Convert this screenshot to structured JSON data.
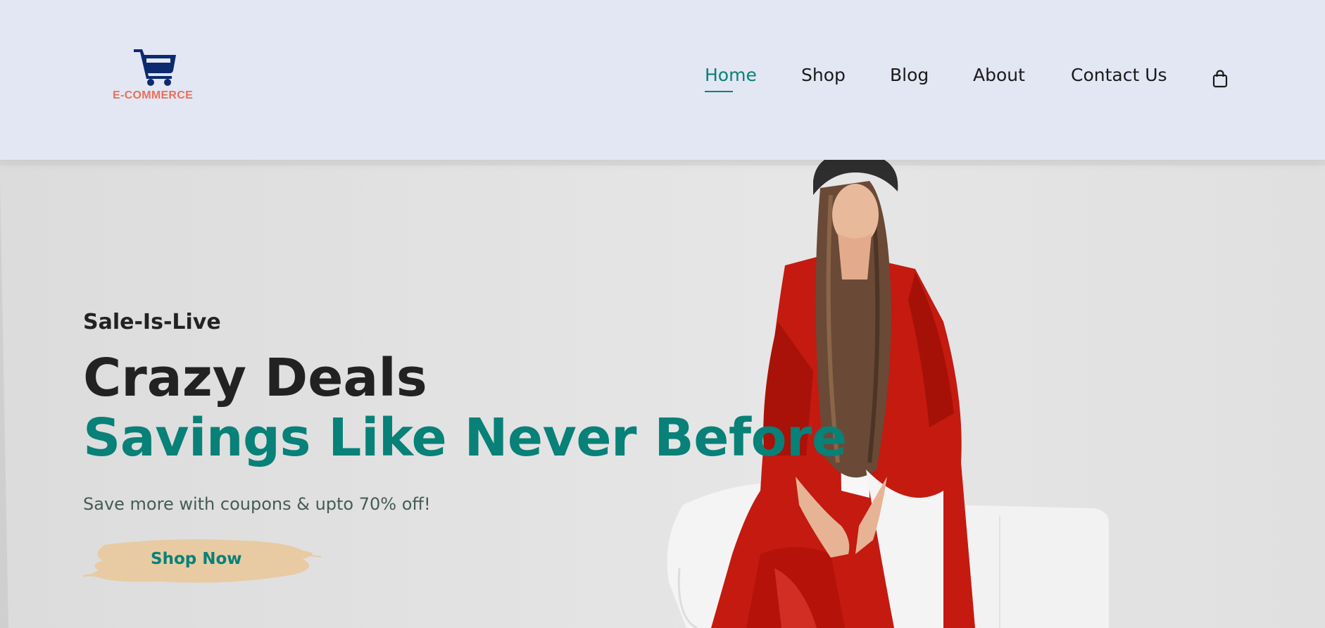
{
  "brand": {
    "logo_text": "E-COMMERCE",
    "logo_icon": "shopping-cart-icon",
    "logo_color": "#0b2b6e",
    "logo_text_color": "#e8715a"
  },
  "nav": {
    "items": [
      {
        "label": "Home",
        "active": true
      },
      {
        "label": "Shop",
        "active": false
      },
      {
        "label": "Blog",
        "active": false
      },
      {
        "label": "About",
        "active": false
      },
      {
        "label": "Contact Us",
        "active": false
      }
    ],
    "bag_icon": "shopping-bag-icon",
    "active_color": "#088178"
  },
  "hero": {
    "eyebrow": "Sale-Is-Live",
    "headline_1": "Crazy Deals",
    "headline_2": "Savings Like Never Before",
    "subtext": "Save more with coupons & upto 70% off!",
    "cta_label": "Shop Now",
    "cta_bg_color": "#e8cba3",
    "accent_color": "#088178"
  }
}
